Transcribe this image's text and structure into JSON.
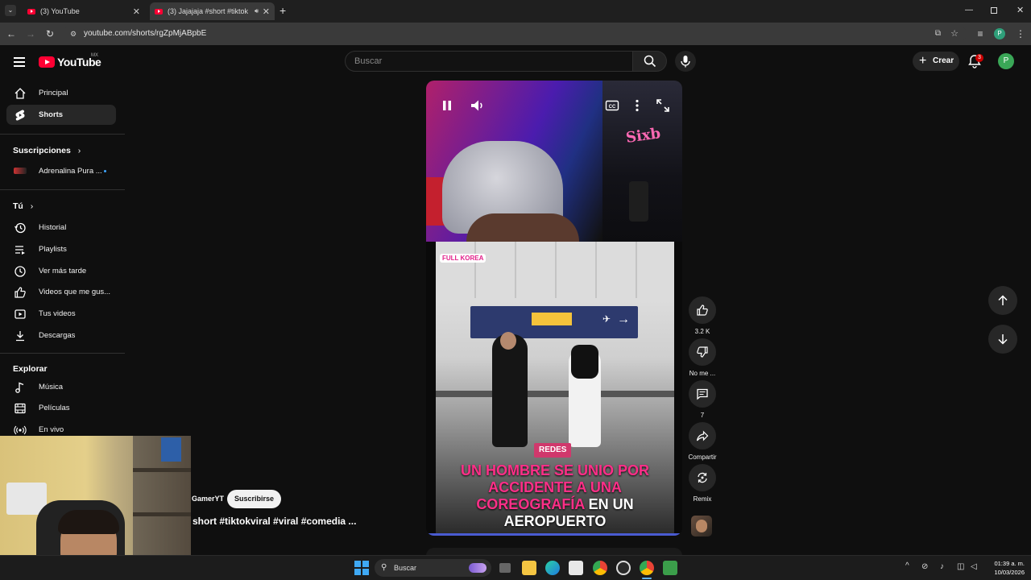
{
  "browser": {
    "tabs": [
      {
        "label": "(3) YouTube",
        "active": false
      },
      {
        "label": "(3) Jajajaja #short #tiktokvi",
        "active": true
      }
    ],
    "url": "youtube.com/shorts/rgZpMjABpbE",
    "profile_initial": "P"
  },
  "header": {
    "logo_text": "YouTube",
    "country_code": "MX",
    "search_placeholder": "Buscar",
    "create_label": "Crear",
    "notification_count": "3",
    "avatar_initial": "P"
  },
  "sidebar": {
    "top_items": [
      {
        "label": "Principal",
        "icon": "home-icon"
      },
      {
        "label": "Shorts",
        "icon": "shorts-icon",
        "active": true
      }
    ],
    "subscriptions_heading": "Suscripciones",
    "subscriptions": [
      {
        "label": "Adrenalina Pura ..."
      }
    ],
    "you_heading": "Tú",
    "you_items": [
      {
        "label": "Historial",
        "icon": "history-icon"
      },
      {
        "label": "Playlists",
        "icon": "playlists-icon"
      },
      {
        "label": "Ver más tarde",
        "icon": "clock-icon"
      },
      {
        "label": "Videos que me gus...",
        "icon": "thumbs-up-icon"
      },
      {
        "label": "Tus videos",
        "icon": "video-icon"
      },
      {
        "label": "Descargas",
        "icon": "download-icon"
      }
    ],
    "explore_heading": "Explorar",
    "explore_items": [
      {
        "label": "Música",
        "icon": "music-icon"
      },
      {
        "label": "Películas",
        "icon": "film-icon"
      },
      {
        "label": "En vivo",
        "icon": "live-icon"
      }
    ]
  },
  "short": {
    "overlay_badge": "REDES",
    "headline_pink": "UN HOMBRE SE UNIO POR ACCIDENTE A UNA COREOGRAFÍA",
    "headline_white_1": "EN UN",
    "headline_white_2": "AEROPUERTO",
    "watermark": "FULL KOREA",
    "neon_sign": "Sixb",
    "channel_name": "GamerYT",
    "subscribe_label": "Suscribirse",
    "title": "short #tiktokviral #viral #comedia ..."
  },
  "actions": {
    "like_count": "3.2 K",
    "dislike_label": "No me ...",
    "comment_count": "7",
    "share_label": "Compartir",
    "remix_label": "Remix"
  },
  "taskbar": {
    "search_placeholder": "Buscar",
    "time": "01:39 a. m.",
    "date": "10/03/2026"
  }
}
